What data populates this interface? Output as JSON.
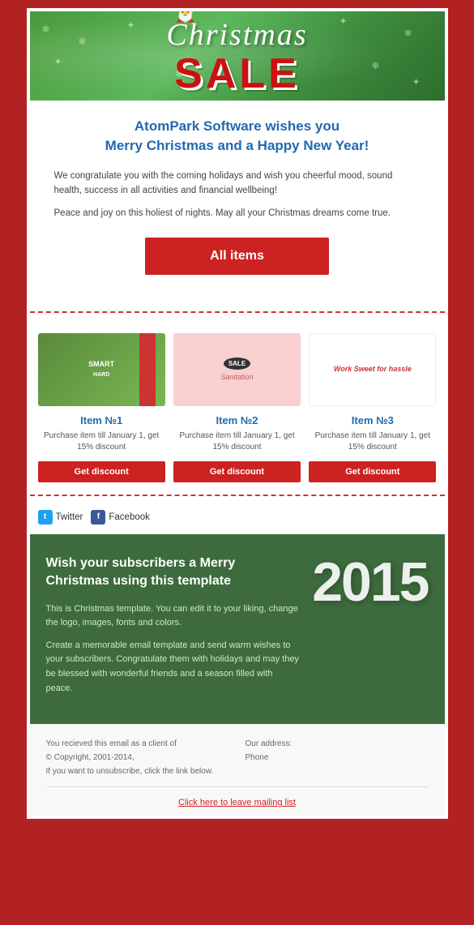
{
  "header": {
    "christmas_text": "Christmas",
    "sale_text": "SALE"
  },
  "greeting": {
    "title_line1": "AtomPark Software wishes you",
    "title_line2": "Merry Christmas and a Happy New Year!",
    "body1": "We congratulate you with the coming holidays and wish you cheerful mood, sound health, success in all activities and financial wellbeing!",
    "body2": "Peace and joy on this holiest of nights. May all your Christmas dreams come true."
  },
  "all_items_button": {
    "label": "All items"
  },
  "items": [
    {
      "name": "Item №1",
      "desc": "Purchase item till January 1, get 15% discount",
      "btn_label": "Get discount",
      "img_text1": "SMART",
      "img_text2": "HARD"
    },
    {
      "name": "Item №2",
      "desc": "Purchase item till January 1, get 15% discount",
      "btn_label": "Get discount",
      "img_badge": "SALE",
      "img_text": "Sanitation"
    },
    {
      "name": "Item №3",
      "desc": "Purchase item till January 1, get 15% discount",
      "btn_label": "Get discount",
      "img_text": "Work Sweet for hassle"
    }
  ],
  "social": {
    "twitter_label": "Twitter",
    "facebook_label": "Facebook"
  },
  "promo": {
    "title": "Wish your subscribers a Merry Christmas using this template",
    "body1": "This is Christmas template. You can edit it to your liking, change the logo, images, fonts and colors.",
    "body2": "Create a memorable email template and send warm wishes to your subscribers. Congratulate them with holidays and may they be blessed with wonderful friends and a season filled with peace.",
    "year": "2015"
  },
  "footer": {
    "left_line1": "You recieved this email as a client of",
    "left_line2": "© Copyright, 2001-2014,",
    "left_line3": "If you want to unsubscribe, click the link below.",
    "right_line1": "Our address:",
    "right_line2": "",
    "right_line3": "Phone",
    "unsubscribe_link": "Click here to leave mailing list"
  }
}
